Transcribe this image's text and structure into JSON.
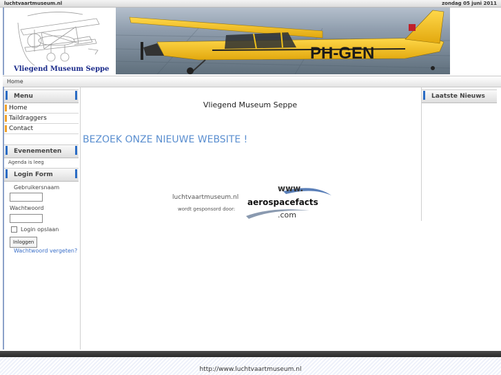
{
  "topbar": {
    "site_url": "luchtvaartmuseum.nl",
    "date": "zondag 05 juni 2011"
  },
  "header": {
    "logo_text": "Vliegend Museum Seppe",
    "banner_registration": "PH-GEN"
  },
  "navbar": {
    "home": "Home"
  },
  "left": {
    "menu_title": "Menu",
    "menu_items": [
      {
        "label": "Home"
      },
      {
        "label": "Taildraggers"
      },
      {
        "label": "Contact"
      }
    ],
    "events_title": "Evenementen",
    "agenda_text": "Agenda is leeg",
    "login_title": "Login Form",
    "username_label": "Gebruikersnaam",
    "password_label": "Wachtwoord",
    "remember_label": "Login opslaan",
    "login_button": "Inloggen",
    "forgot_link": "Wachtwoord vergeten?"
  },
  "main": {
    "title": "Vliegend Museum Seppe",
    "visit_link": "BEZOEK ONZE NIEUWE WEBSITE !",
    "sponsor_site": "luchtvaartmuseum.nl",
    "sponsor_text": "wordt gesponsord door:",
    "sponsor_logo_top": "www.",
    "sponsor_logo_main": "aerospacefacts",
    "sponsor_logo_bottom": ".com"
  },
  "right": {
    "news_title": "Laatste Nieuws"
  },
  "footer": {
    "url": "http://www.luchtvaartmuseum.nl"
  },
  "colors": {
    "accent_blue": "#2b6cc4",
    "menu_orange": "#f0a028",
    "plane_yellow": "#f2c21a",
    "link_blue": "#3a6fc8"
  }
}
